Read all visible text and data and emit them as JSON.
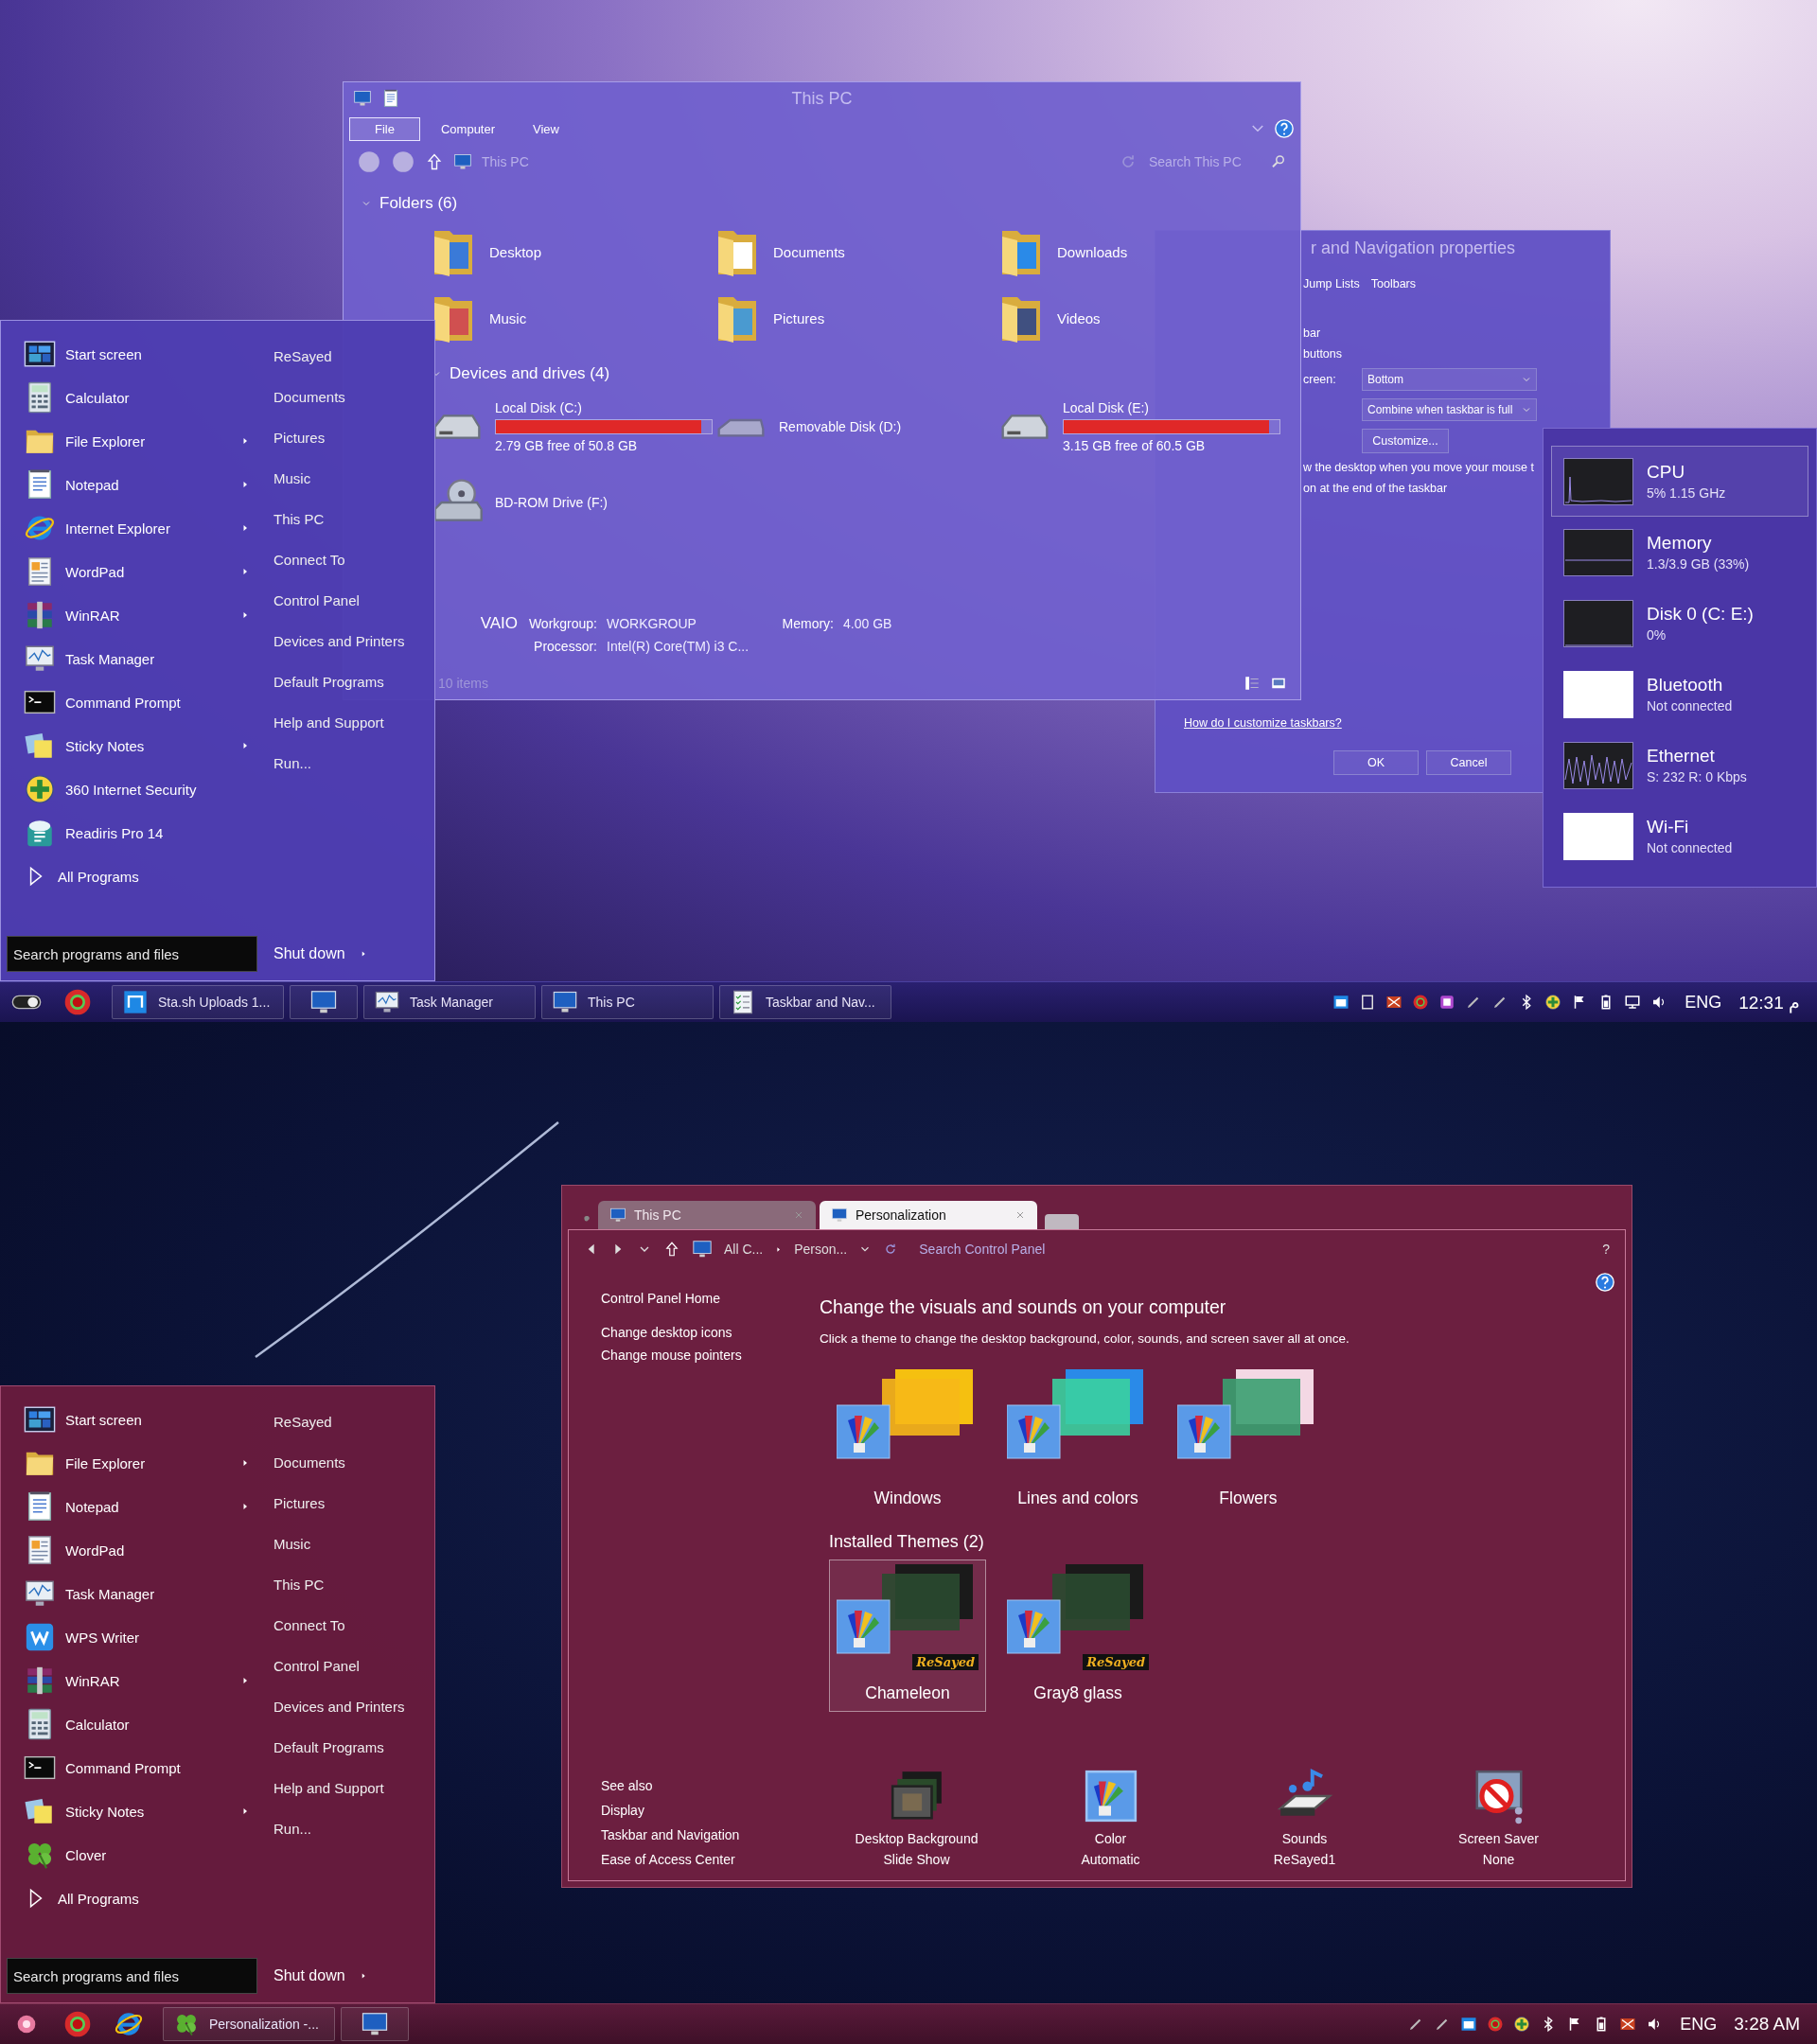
{
  "top_desktop": {
    "explorer": {
      "title": "This PC",
      "ribbon_tabs": [
        {
          "label": "File",
          "selected": true
        },
        {
          "label": "Computer",
          "selected": false
        },
        {
          "label": "View",
          "selected": false
        }
      ],
      "address": "This PC",
      "search": {
        "placeholder": "Search This PC"
      },
      "folders_heading": "Folders (6)",
      "folders": [
        "Desktop",
        "Documents",
        "Downloads",
        "Music",
        "Pictures",
        "Videos"
      ],
      "drives_heading": "Devices and drives (4)",
      "drives": [
        {
          "kind": "disk",
          "name": "Local Disk (C:)",
          "level": 0.95,
          "space": "2.79 GB free of 50.8 GB"
        },
        {
          "kind": "removable",
          "name": "Removable Disk (D:)"
        },
        {
          "kind": "disk",
          "name": "Local Disk (E:)",
          "level": 0.95,
          "space": "3.15 GB free of 60.5 GB"
        },
        {
          "kind": "optical",
          "name": "BD-ROM Drive (F:)"
        }
      ],
      "computer_name": "VAIO",
      "details": [
        {
          "label": "Workgroup:",
          "value": "WORKGROUP"
        },
        {
          "label": "Memory:",
          "value": "4.00 GB"
        },
        {
          "label": "Processor:",
          "value": "Intel(R) Core(TM) i3 C..."
        }
      ],
      "status": "10 items"
    },
    "properties_dialog": {
      "title": "r and Navigation properties",
      "tabs": [
        "Jump Lists",
        "Toolbars"
      ],
      "rows": [
        {
          "kind": "text",
          "text": "bar"
        },
        {
          "kind": "text",
          "text": "buttons"
        },
        {
          "kind": "select",
          "label": "creen:",
          "value": "Bottom"
        },
        {
          "kind": "select",
          "value": "Combine when taskbar is full"
        },
        {
          "kind": "button",
          "text": "Customize..."
        },
        {
          "kind": "text",
          "text": "w the desktop when you move your mouse t"
        },
        {
          "kind": "text",
          "text": "on at the end of the taskbar"
        }
      ],
      "link": "How do I customize taskbars?",
      "buttons": [
        "OK",
        "Cancel"
      ]
    },
    "performance": {
      "items": [
        {
          "name": "CPU",
          "reading": "5% 1.15 GHz",
          "kind": "spike",
          "selected": true
        },
        {
          "name": "Memory",
          "reading": "1.3/3.9 GB (33%)",
          "kind": "flat",
          "selected": false
        },
        {
          "name": "Disk 0 (C: E:)",
          "reading": "0%",
          "kind": "zero",
          "selected": false
        },
        {
          "name": "Bluetooth",
          "reading": "Not connected",
          "kind": "blank",
          "selected": false
        },
        {
          "name": "Ethernet",
          "reading": "S: 232 R: 0 Kbps",
          "kind": "wave",
          "selected": false
        },
        {
          "name": "Wi-Fi",
          "reading": "Not connected",
          "kind": "blank",
          "selected": false
        }
      ]
    },
    "start_menu": {
      "programs": [
        {
          "label": "Start screen",
          "submenu": false
        },
        {
          "label": "Calculator",
          "submenu": false
        },
        {
          "label": "File Explorer",
          "submenu": true
        },
        {
          "label": "Notepad",
          "submenu": true
        },
        {
          "label": "Internet Explorer",
          "submenu": true
        },
        {
          "label": "WordPad",
          "submenu": true
        },
        {
          "label": "WinRAR",
          "submenu": true
        },
        {
          "label": "Task Manager",
          "submenu": false
        },
        {
          "label": "Command Prompt",
          "submenu": false
        },
        {
          "label": "Sticky Notes",
          "submenu": true
        },
        {
          "label": "360 Internet Security",
          "submenu": false
        },
        {
          "label": "Readiris Pro 14",
          "submenu": false
        }
      ],
      "all_programs": "All Programs",
      "places": [
        "ReSayed",
        "Documents",
        "Pictures",
        "Music",
        "This PC",
        "Connect To",
        "Control Panel",
        "Devices and Printers",
        "Default Programs",
        "Help and Support",
        "Run..."
      ],
      "search": {
        "placeholder": "Search programs and files"
      },
      "shutdown": "Shut down"
    },
    "taskbar": {
      "buttons": [
        {
          "kind": "window",
          "label": "Sta.sh Uploads 1..."
        },
        {
          "kind": "pinned"
        },
        {
          "kind": "window",
          "label": "Task Manager"
        },
        {
          "kind": "window",
          "label": "This PC"
        },
        {
          "kind": "window",
          "label": "Taskbar and Nav..."
        }
      ],
      "language": "ENG",
      "clock": "12:31 م"
    }
  },
  "bottom_desktop": {
    "window": {
      "tabs": [
        {
          "label": "This PC",
          "selected": false
        },
        {
          "label": "Personalization",
          "selected": true
        }
      ],
      "breadcrumb": [
        "All C...",
        "Person..."
      ],
      "search": {
        "placeholder": "Search Control Panel"
      },
      "help": "?",
      "tasks": [
        "Control Panel Home",
        "Change desktop icons",
        "Change mouse pointers"
      ],
      "heading": "Change the visuals and sounds on your computer",
      "intro": "Click a theme to change the desktop background, color, sounds, and screen saver all at once.",
      "themes": [
        {
          "name": "Windows",
          "selected": false
        },
        {
          "name": "Lines and colors",
          "selected": false
        },
        {
          "name": "Flowers",
          "selected": false
        }
      ],
      "installed_heading": "Installed Themes (2)",
      "installed_themes": [
        {
          "name": "Chameleon",
          "badge": "ReSayed",
          "selected": true
        },
        {
          "name": "Gray8 glass",
          "badge": "ReSayed",
          "selected": false
        }
      ],
      "see_also": {
        "heading": "See also",
        "links": [
          "Display",
          "Taskbar and Navigation",
          "Ease of Access Center"
        ]
      },
      "settings": [
        {
          "title": "Desktop Background",
          "value": "Slide Show"
        },
        {
          "title": "Color",
          "value": "Automatic"
        },
        {
          "title": "Sounds",
          "value": "ReSayed1"
        },
        {
          "title": "Screen Saver",
          "value": "None"
        }
      ]
    },
    "start_menu": {
      "programs": [
        {
          "label": "Start screen",
          "submenu": false
        },
        {
          "label": "File Explorer",
          "submenu": true
        },
        {
          "label": "Notepad",
          "submenu": true
        },
        {
          "label": "WordPad",
          "submenu": false
        },
        {
          "label": "Task Manager",
          "submenu": false
        },
        {
          "label": "WPS Writer",
          "submenu": false
        },
        {
          "label": "WinRAR",
          "submenu": true
        },
        {
          "label": "Calculator",
          "submenu": false
        },
        {
          "label": "Command Prompt",
          "submenu": false
        },
        {
          "label": "Sticky Notes",
          "submenu": true
        },
        {
          "label": "Clover",
          "submenu": false
        }
      ],
      "all_programs": "All Programs",
      "places": [
        "ReSayed",
        "Documents",
        "Pictures",
        "Music",
        "This PC",
        "Connect To",
        "Control Panel",
        "Devices and Printers",
        "Default Programs",
        "Help and Support",
        "Run..."
      ],
      "search": {
        "placeholder": "Search programs and files"
      },
      "shutdown": "Shut down"
    },
    "taskbar": {
      "buttons": [
        {
          "kind": "window",
          "label": "Personalization -..."
        },
        {
          "kind": "pinned"
        }
      ],
      "language": "ENG",
      "clock": "3:28 AM"
    }
  }
}
